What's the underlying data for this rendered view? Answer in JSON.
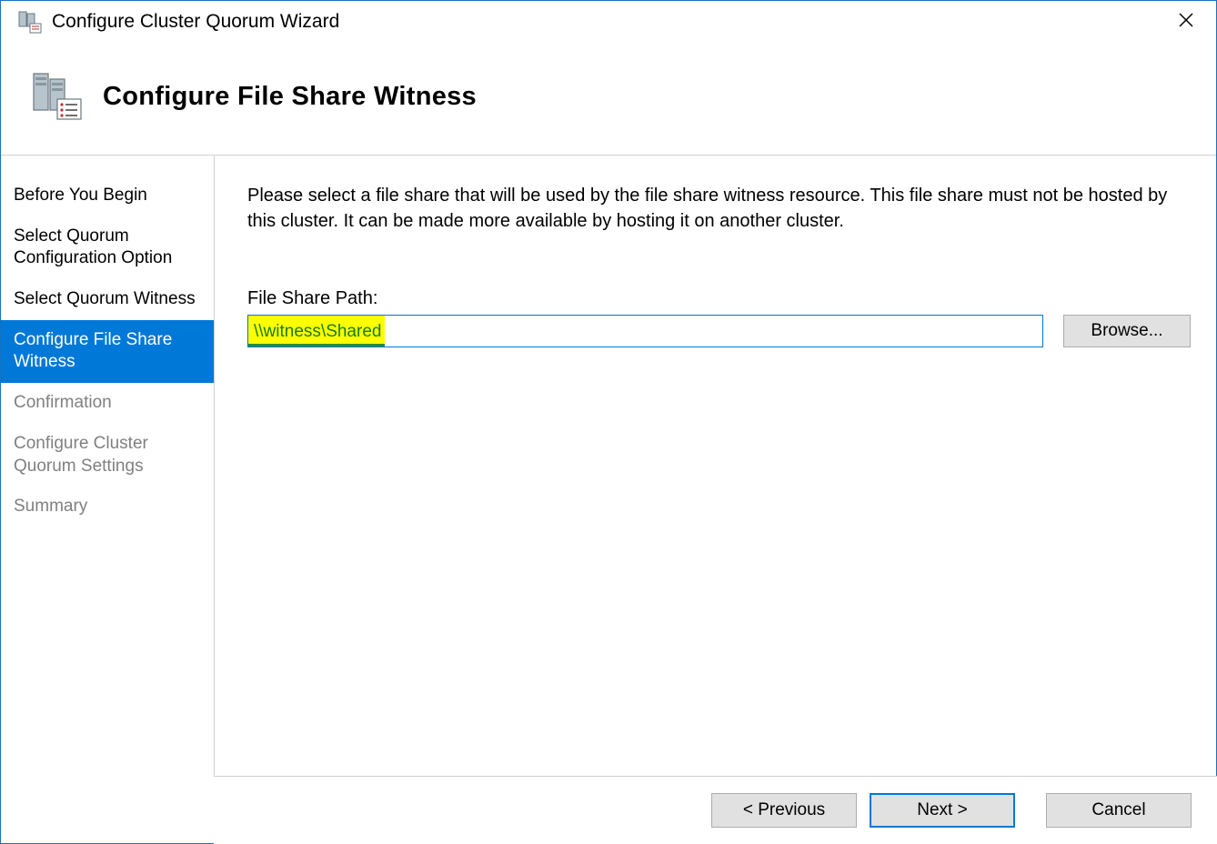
{
  "window": {
    "title": "Configure Cluster Quorum Wizard"
  },
  "header": {
    "page_title": "Configure File Share Witness"
  },
  "sidebar": {
    "items": [
      {
        "label": "Before You Begin",
        "state": "normal"
      },
      {
        "label": "Select Quorum Configuration Option",
        "state": "normal"
      },
      {
        "label": "Select Quorum Witness",
        "state": "normal"
      },
      {
        "label": "Configure File Share Witness",
        "state": "selected"
      },
      {
        "label": "Confirmation",
        "state": "disabled"
      },
      {
        "label": "Configure Cluster Quorum Settings",
        "state": "disabled"
      },
      {
        "label": "Summary",
        "state": "disabled"
      }
    ]
  },
  "main": {
    "instruction": "Please select a file share that will be used by the file share witness resource.  This file share must not be hosted by this cluster.  It can be made more available by hosting it on another cluster.",
    "field_label": "File Share Path:",
    "path_value": "\\\\witness\\Shared",
    "browse_label": "Browse..."
  },
  "footer": {
    "previous": "< Previous",
    "next": "Next >",
    "cancel": "Cancel"
  }
}
